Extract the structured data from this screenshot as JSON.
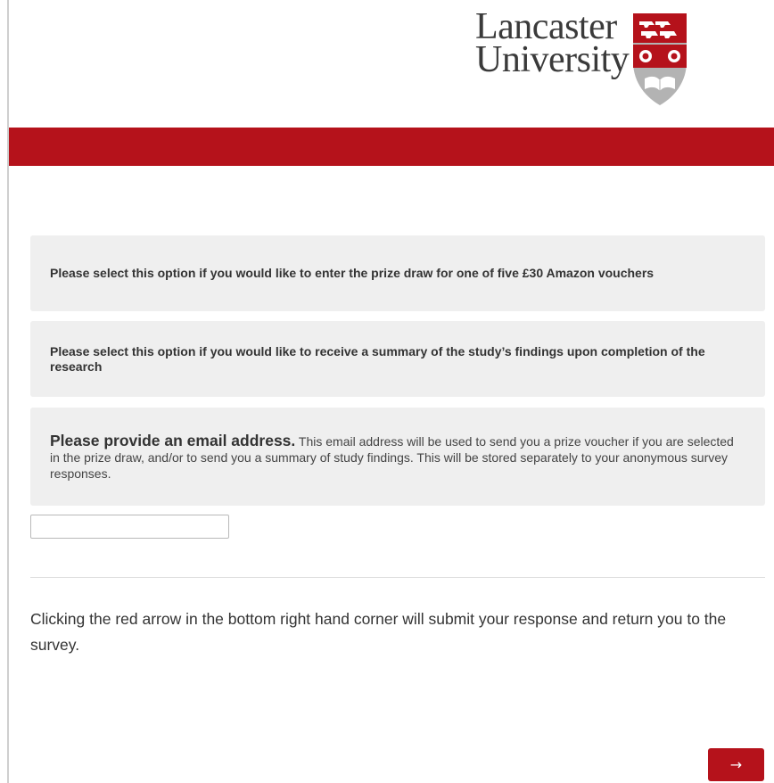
{
  "header": {
    "logo_line1": "Lancaster",
    "logo_line2": "University"
  },
  "colors": {
    "brand_red": "#b5121b",
    "panel_bg": "#efefef",
    "crest_grey": "#b3b3b3"
  },
  "questions": [
    {
      "label": "Please select this option if you would like to enter the prize draw for one of five £30 Amazon vouchers"
    },
    {
      "label": "Please select this option if you would like to receive a summary of the study’s findings upon completion of the research"
    },
    {
      "heading": "Please provide an email address.",
      "description": " This email address will be used to send you a prize voucher if you are selected in the prize draw, and/or to send you a summary of study findings. This will be stored separately to your anonymous survey responses."
    }
  ],
  "email_field": {
    "value": "",
    "placeholder": ""
  },
  "instructions": "Clicking the red arrow in the bottom right hand corner will submit your response and return you to the survey.",
  "next_button": {
    "label": "→",
    "icon": "arrow-right-icon"
  }
}
